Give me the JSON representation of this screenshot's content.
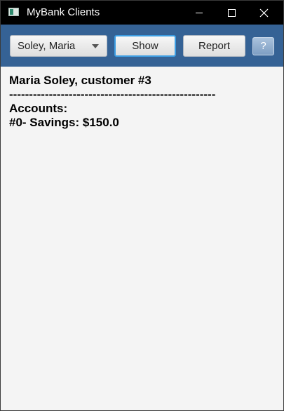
{
  "window": {
    "title": "MyBank Clients",
    "controls": [
      "minimize-icon",
      "maximize-icon",
      "close-icon"
    ]
  },
  "toolbar": {
    "client_select": {
      "selected": "Soley, Maria"
    },
    "show_label": "Show",
    "report_label": "Report",
    "help_label": "?"
  },
  "details": {
    "header": "Maria Soley, customer #3",
    "separator": "----------------------------------------------------",
    "accounts_label": "Accounts:",
    "accounts": [
      "#0- Savings: $150.0"
    ]
  },
  "colors": {
    "titlebar": "#000000",
    "toolbar": "#356295",
    "content_bg": "#f4f4f4",
    "show_focus_border": "#3c9de2"
  }
}
